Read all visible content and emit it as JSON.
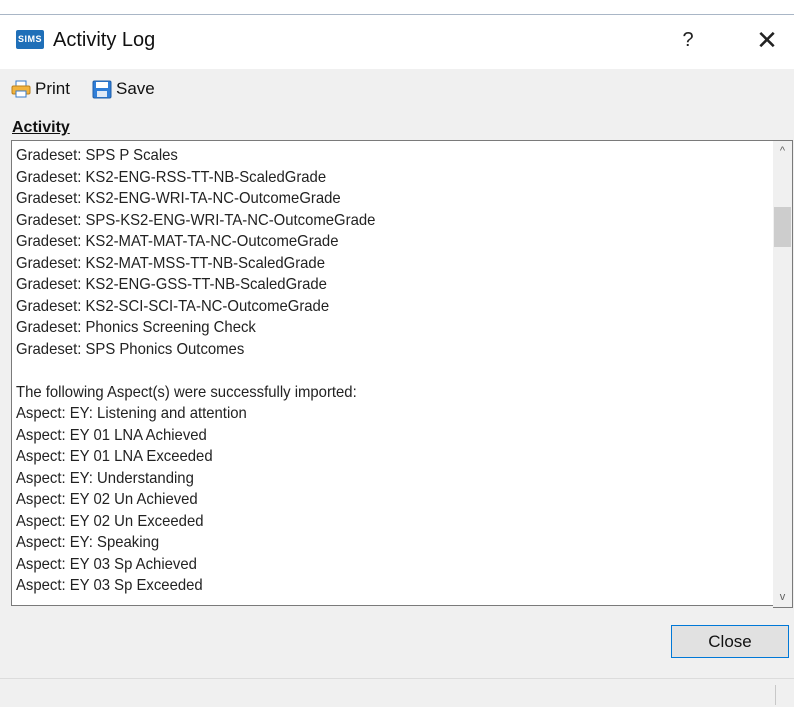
{
  "window": {
    "title": "Activity Log",
    "app_logo_text": "SIMS",
    "help_label": "?",
    "close_glyph": "✕"
  },
  "toolbar": {
    "print_label": "Print",
    "save_label": "Save",
    "print_icon": "printer-icon",
    "save_icon": "floppy-disk-icon"
  },
  "activity": {
    "label": "Activity",
    "lines": [
      "Gradeset: SPS P Scales",
      "Gradeset: KS2-ENG-RSS-TT-NB-ScaledGrade",
      "Gradeset: KS2-ENG-WRI-TA-NC-OutcomeGrade",
      "Gradeset: SPS-KS2-ENG-WRI-TA-NC-OutcomeGrade",
      "Gradeset: KS2-MAT-MAT-TA-NC-OutcomeGrade",
      "Gradeset: KS2-MAT-MSS-TT-NB-ScaledGrade",
      "Gradeset: KS2-ENG-GSS-TT-NB-ScaledGrade",
      "Gradeset: KS2-SCI-SCI-TA-NC-OutcomeGrade",
      "Gradeset: Phonics Screening Check",
      "Gradeset: SPS Phonics Outcomes",
      "",
      "The following Aspect(s) were successfully imported:",
      "Aspect: EY: Listening and attention",
      "Aspect: EY 01 LNA Achieved",
      "Aspect: EY 01 LNA Exceeded",
      "Aspect: EY: Understanding",
      "Aspect: EY 02 Un Achieved",
      "Aspect: EY 02 Un Exceeded",
      "Aspect: EY: Speaking",
      "Aspect: EY 03 Sp Achieved",
      "Aspect: EY 03 Sp Exceeded"
    ]
  },
  "scrollbar": {
    "up_glyph": "^",
    "down_glyph": "v"
  },
  "footer": {
    "close_label": "Close"
  },
  "colors": {
    "logo_bg": "#1f6fb8",
    "button_focus_border": "#0078d7"
  }
}
